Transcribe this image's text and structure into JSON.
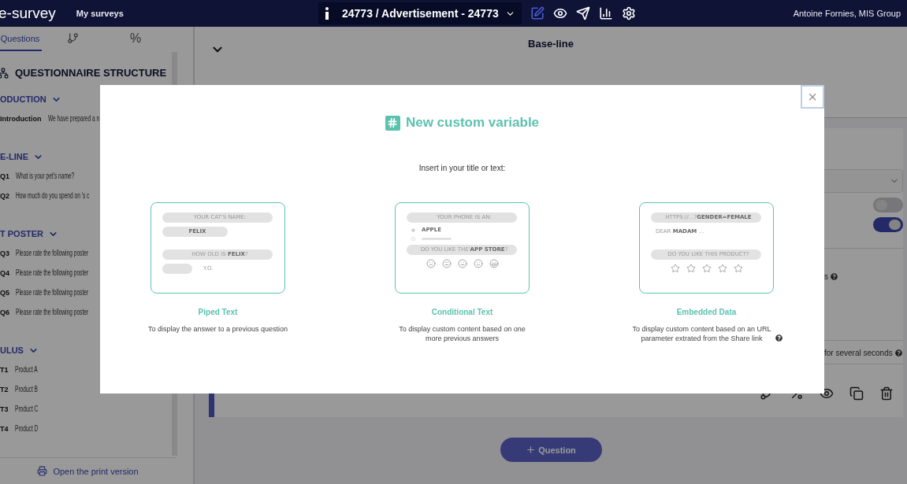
{
  "top_bar": {
    "logo": "e-survey",
    "nav_link": "My surveys",
    "survey_title": "24773 / Advertisement - 24773",
    "tools": [
      {
        "kind": "edit",
        "selected": true
      },
      {
        "kind": "preview",
        "selected": false
      },
      {
        "kind": "send",
        "selected": false
      },
      {
        "kind": "results",
        "selected": false
      },
      {
        "kind": "settings",
        "selected": false
      }
    ],
    "user": "Antoine Fornies, MIS Group"
  },
  "sidebar": {
    "tabs": [
      {
        "kind": "text",
        "label": "Questions",
        "selected": true
      },
      {
        "kind": "branch",
        "selected": false
      },
      {
        "kind": "text",
        "label": "%",
        "selected": false
      }
    ],
    "heading": "QUESTIONNAIRE STRUCTURE",
    "sections": [
      {
        "title": "ODUCTION",
        "expanded": true,
        "items": [
          {
            "code": "Introduction",
            "text": "We have prepared a n"
          }
        ]
      },
      {
        "title": "E-LINE",
        "expanded": true,
        "items": [
          {
            "code": "Q1",
            "text": "What is your pet's name?"
          },
          {
            "code": "Q2",
            "text": "How much do you spend on 's c"
          }
        ]
      },
      {
        "title": "T POSTER",
        "expanded": true,
        "items": [
          {
            "code": "Q3",
            "text": "Please rate the following poster"
          },
          {
            "code": "Q4",
            "text": "Please rate the following poster"
          },
          {
            "code": "Q5",
            "text": "Please rate the following poster"
          },
          {
            "code": "Q6",
            "text": "Please rate the following poster"
          }
        ]
      },
      {
        "title": "ULUS",
        "expanded": true,
        "items": [
          {
            "code": "T1",
            "text": "Product A"
          },
          {
            "code": "T2",
            "text": "Product B"
          },
          {
            "code": "T3",
            "text": "Product C"
          },
          {
            "code": "T4",
            "text": "Product D"
          }
        ]
      }
    ],
    "print_link": "Open the print version"
  },
  "main": {
    "section_title": "Base-line",
    "expanded": true,
    "toggles": [
      {
        "on": false
      },
      {
        "on": true
      }
    ],
    "texts": [
      "s",
      "for several seconds"
    ],
    "add_button": "Question"
  },
  "modal": {
    "close": "×",
    "title": "New custom variable",
    "instruction": "Insert in your title or text:",
    "options": [
      {
        "title": "Piped Text",
        "description": "To display the answer to a previous question",
        "help": false,
        "lines": [
          {
            "kind": "pill",
            "text": "YOUR CAT'S NAME:"
          },
          {
            "kind": "answer",
            "text": "FELIX"
          },
          {
            "kind": "pill",
            "text": "HOW OLD IS **FELIX**?"
          },
          {
            "kind": "suffix",
            "text": "Y.O."
          }
        ]
      },
      {
        "title": "Conditional Text",
        "description": "To display custom content based on one more previous answers",
        "help": false,
        "lines": [
          {
            "kind": "pill",
            "text": "YOUR PHONE IS AN:"
          },
          {
            "kind": "option",
            "text": "APPLE",
            "selected": true
          },
          {
            "kind": "option",
            "selected": false
          },
          {
            "kind": "pill",
            "text": "DO YOU LIKE THE'**APP STORE**?"
          },
          {
            "kind": "faces"
          }
        ]
      },
      {
        "title": "Embedded Data",
        "description": "To display custom content based on an URL parameter extrated from the Share link",
        "help": true,
        "lines": [
          {
            "kind": "pill",
            "text": "HTTPS://...?**GENDER=FEMALE**"
          },
          {
            "kind": "plain",
            "text": "DEAR **MADAM** ..."
          },
          {
            "kind": "pill",
            "text": "DO YOU LIKE THIS PRODUCT?"
          },
          {
            "kind": "stars"
          }
        ]
      }
    ]
  }
}
